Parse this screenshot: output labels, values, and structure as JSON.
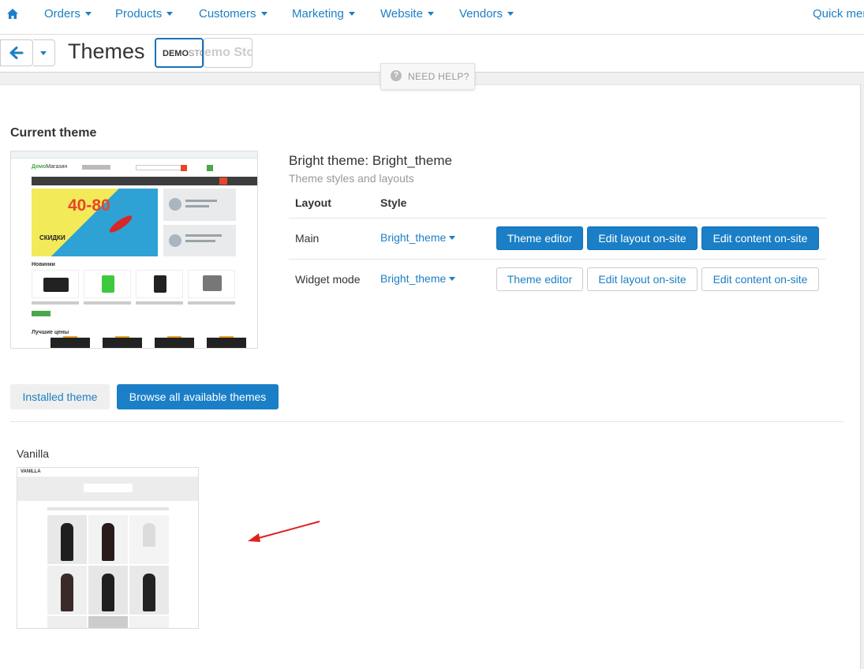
{
  "nav": {
    "items": [
      "Orders",
      "Products",
      "Customers",
      "Marketing",
      "Website",
      "Vendors"
    ],
    "quick_menu": "Quick mer"
  },
  "page": {
    "title": "Themes",
    "store_active": {
      "strong": "DEMO",
      "light": "STO"
    },
    "store_inactive": "emo Sto"
  },
  "help": {
    "label": "NEED HELP?"
  },
  "current_theme": {
    "section_title": "Current theme",
    "name": "Bright theme: Bright_theme",
    "subtitle": "Theme styles and layouts",
    "headers": {
      "layout": "Layout",
      "style": "Style"
    },
    "rows": [
      {
        "layout": "Main",
        "style": "Bright_theme",
        "primary": true
      },
      {
        "layout": "Widget mode",
        "style": "Bright_theme",
        "primary": false
      }
    ],
    "buttons": {
      "theme_editor": "Theme editor",
      "edit_layout": "Edit layout on-site",
      "edit_content": "Edit content on-site"
    },
    "preview": {
      "logo_a": "Демо",
      "logo_b": "Магазин",
      "banner_big": "40-80",
      "banner_sale": "СКИДКИ",
      "section1": "Новинки",
      "section2": "Лучшие цены"
    }
  },
  "tabs": {
    "installed": "Installed theme",
    "browse": "Browse all available themes"
  },
  "vanilla": {
    "name": "Vanilla",
    "logo": "VANILLA"
  },
  "colors": {
    "link": "#1c7fc4",
    "primary": "#1a7fc7",
    "arrow": "#e02020"
  }
}
